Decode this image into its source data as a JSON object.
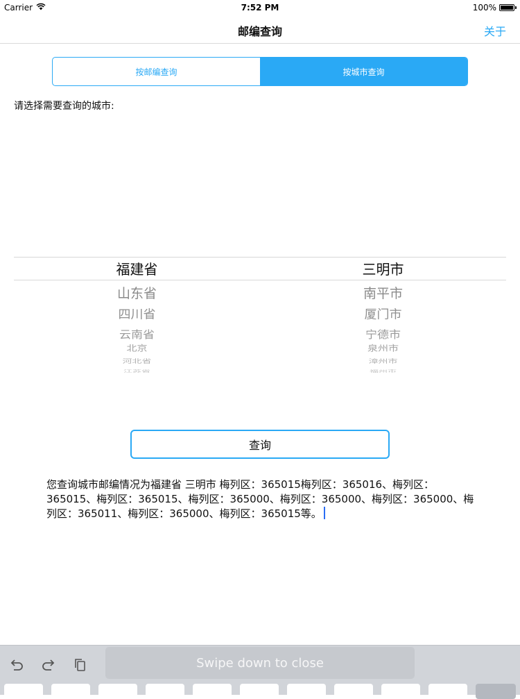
{
  "status_bar": {
    "carrier": "Carrier",
    "time": "7:52 PM",
    "battery": "100%",
    "battery_level": 1.0
  },
  "nav": {
    "title": "邮编查询",
    "about": "关于"
  },
  "segment": {
    "tabs": [
      "按邮编查询",
      "按城市查询"
    ],
    "selected_index": 1
  },
  "prompt": "请选择需要查询的城市:",
  "picker": {
    "provinces": {
      "selected": "福建省",
      "below": [
        "山东省",
        "四川省",
        "云南省",
        "北京",
        "河北省",
        "江苏省"
      ]
    },
    "cities": {
      "selected": "三明市",
      "below": [
        "南平市",
        "厦门市",
        "宁德市",
        "泉州市",
        "漳州市",
        "福州市"
      ]
    }
  },
  "query_button": "查询",
  "result_text": "您查询城市邮编情况为福建省 三明市 梅列区：365015梅列区：365016、梅列区：365015、梅列区：365015、梅列区：365000、梅列区：365000、梅列区：365000、梅列区：365011、梅列区：365000、梅列区：365015等。",
  "keyboard": {
    "swipe_hint": "Swipe down to close"
  },
  "colors": {
    "accent": "#2aa9f5",
    "keyboard_bg": "#d1d4d9",
    "caret": "#2a6df4"
  }
}
